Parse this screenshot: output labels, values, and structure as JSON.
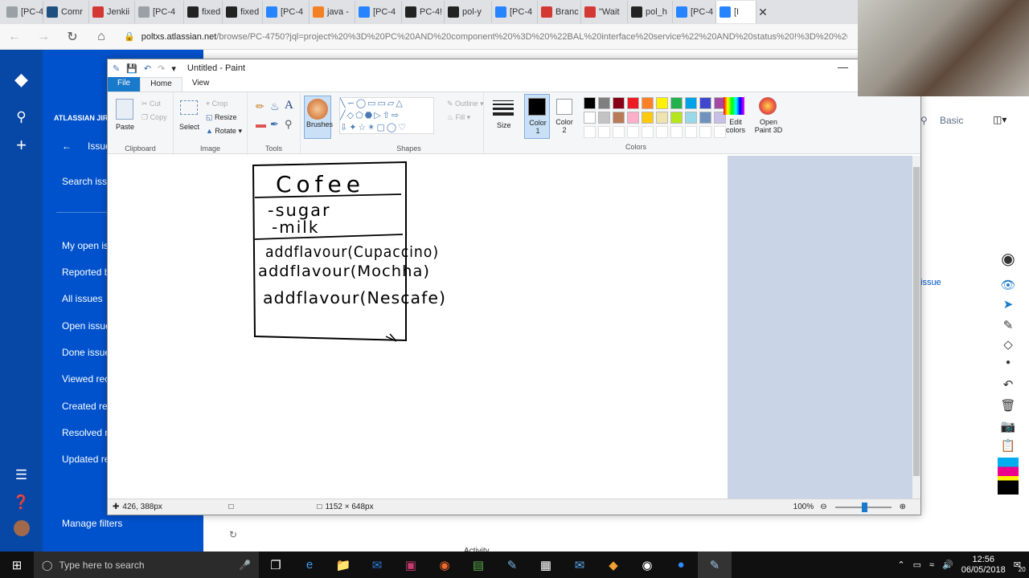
{
  "browser": {
    "tabs": [
      {
        "label": "[PC-4",
        "icon": "page-icon",
        "color": "#9aa0a6"
      },
      {
        "label": "Comr",
        "icon": "confluence-icon",
        "color": "#205081"
      },
      {
        "label": "Jenkii",
        "icon": "jenkins-icon",
        "color": "#d33833"
      },
      {
        "label": "[PC-4",
        "icon": "page-icon",
        "color": "#9aa0a6"
      },
      {
        "label": "fixed",
        "icon": "github-icon",
        "color": "#222"
      },
      {
        "label": "fixed",
        "icon": "github-icon",
        "color": "#222"
      },
      {
        "label": "[PC-4",
        "icon": "jira-icon",
        "color": "#2684ff"
      },
      {
        "label": "java -",
        "icon": "stackoverflow-icon",
        "color": "#f48024"
      },
      {
        "label": "[PC-4",
        "icon": "jira-icon",
        "color": "#2684ff"
      },
      {
        "label": "PC-4!",
        "icon": "github-icon",
        "color": "#222"
      },
      {
        "label": "pol-y",
        "icon": "github-icon",
        "color": "#222"
      },
      {
        "label": "[PC-4",
        "icon": "jira-icon",
        "color": "#2684ff"
      },
      {
        "label": "Branc",
        "icon": "bitbucket-icon",
        "color": "#d33833"
      },
      {
        "label": "\"Wait",
        "icon": "jenkins-icon",
        "color": "#d33833"
      },
      {
        "label": "pol_h",
        "icon": "github-icon",
        "color": "#222"
      },
      {
        "label": "[PC-4",
        "icon": "jira-icon",
        "color": "#2684ff"
      },
      {
        "label": "[I",
        "icon": "jira-icon",
        "color": "#2684ff",
        "active": true
      }
    ],
    "url_host": "poltxs.atlassian.net",
    "url_rest": "/browse/PC-4750?jql=project%20%3D%20PC%20AND%20component%20%3D%20%22BAL%20interface%20service%22%20AND%20status%20!%3D%20%20Cr"
  },
  "jira": {
    "brand": "ATLASSIAN JIR",
    "back_label": "Issue",
    "search_label": "Search issu",
    "filters": [
      "My open is",
      "Reported b",
      "All issues",
      "Open issue",
      "Done issue",
      "Viewed rec",
      "Created re",
      "Resolved re",
      "Updated re"
    ],
    "manage_filters": "Manage filters",
    "view_basic": "Basic",
    "issue_link": "issue",
    "activity": "Activity"
  },
  "paint": {
    "title": "Untitled - Paint",
    "menu": {
      "file": "File",
      "home": "Home",
      "view": "View"
    },
    "clipboard": {
      "paste": "Paste",
      "cut": "Cut",
      "copy": "Copy",
      "label": "Clipboard"
    },
    "image": {
      "select": "Select",
      "crop": "Crop",
      "resize": "Resize",
      "rotate": "Rotate",
      "label": "Image"
    },
    "tools": {
      "label": "Tools"
    },
    "brushes": "Brushes",
    "shapes": {
      "outline": "Outline",
      "fill": "Fill",
      "label": "Shapes"
    },
    "size": "Size",
    "color1": "Color 1",
    "color2": "Color 2",
    "edit_colors": "Edit colors",
    "open_paint3d": "Open Paint 3D",
    "colors_label": "Colors",
    "palette": [
      "#000000",
      "#7f7f7f",
      "#880015",
      "#ed1c24",
      "#ff7f27",
      "#fff200",
      "#22b14c",
      "#00a2e8",
      "#3f48cc",
      "#a349a4",
      "#ffffff",
      "#c3c3c3",
      "#b97a57",
      "#ffaec9",
      "#ffc90e",
      "#efe4b0",
      "#b5e61d",
      "#99d9ea",
      "#7092be",
      "#c8bfe7"
    ],
    "drawing": {
      "class_name": "Cofee",
      "attributes": [
        "-sugar",
        "-milk"
      ],
      "methods": [
        "addflavour(Cupaccino)",
        "addflavour(Mochha)",
        "addflavour(Nescafe)"
      ]
    },
    "status": {
      "cursor": "426, 388px",
      "canvas_size": "1152 × 648px",
      "zoom": "100%"
    }
  },
  "taskbar": {
    "search_placeholder": "Type here to search",
    "time": "12:56",
    "date": "06/05/2018",
    "notif_count": "20"
  }
}
